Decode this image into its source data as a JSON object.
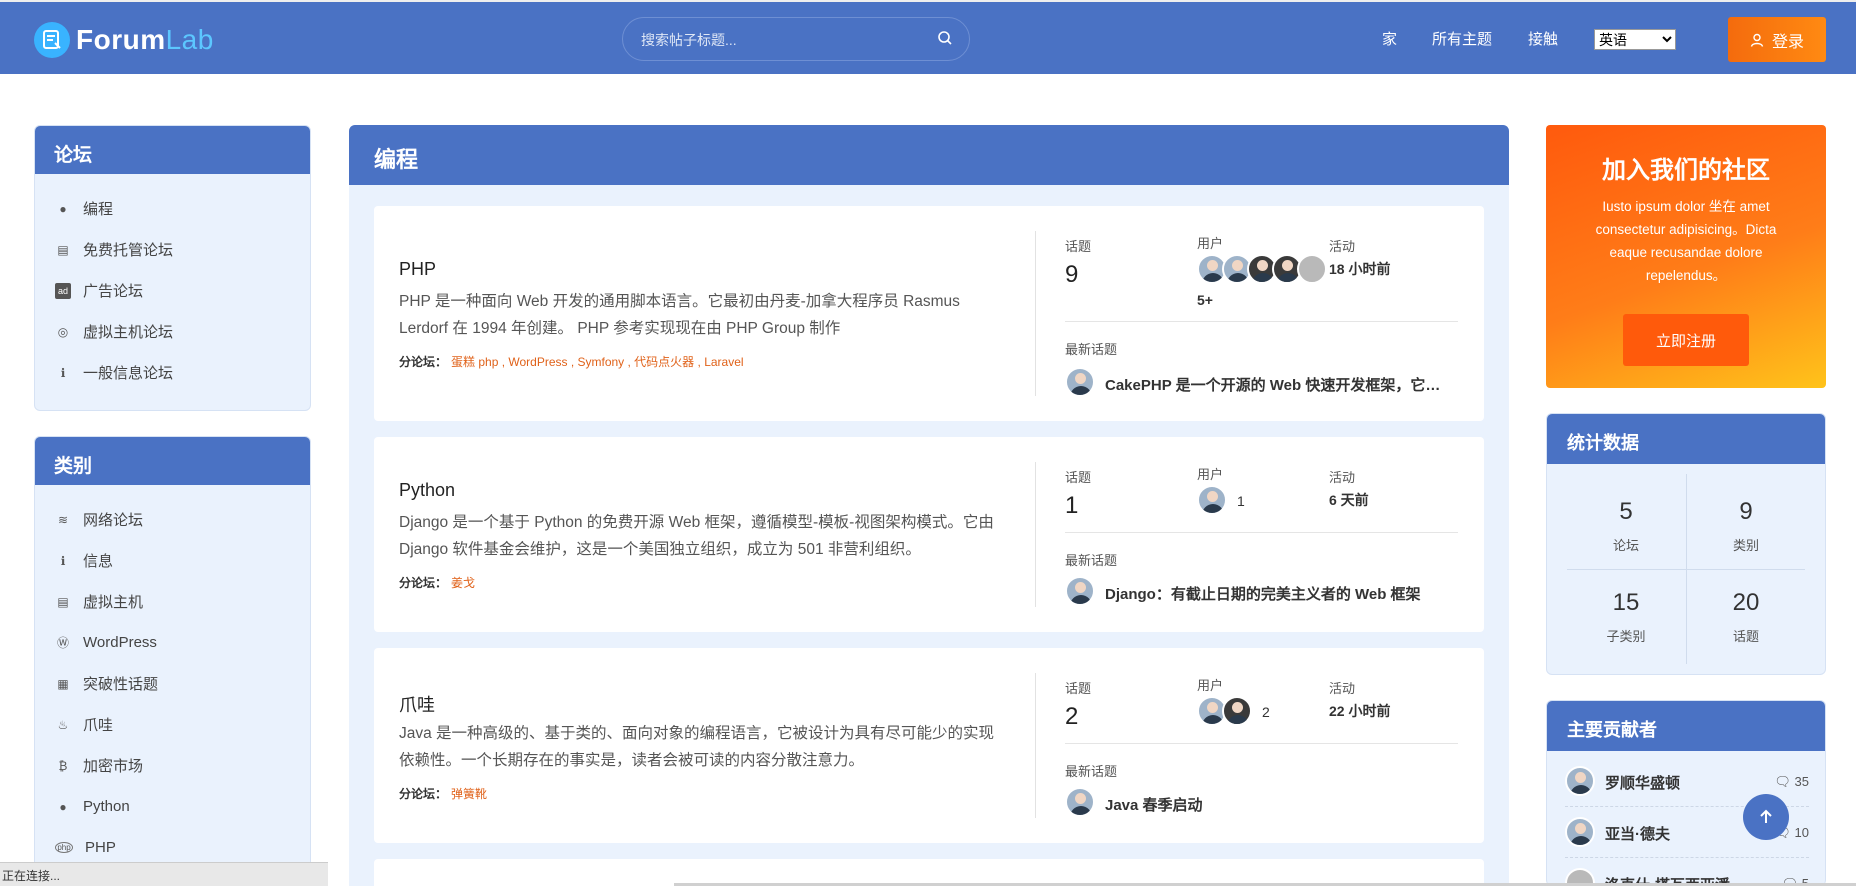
{
  "app": {
    "logo_forum": "Forum",
    "logo_lab": "Lab",
    "colors": {
      "primary": "#4a72c4",
      "accent": "#f46b0d",
      "panel": "#eaf2fd",
      "link": "#e0621a"
    }
  },
  "header": {
    "search_placeholder": "搜索帖子标题...",
    "nav": [
      "家",
      "所有主题",
      "接触"
    ],
    "language": "英语",
    "login_label": "登录"
  },
  "sidebar": {
    "forums_title": "论坛",
    "forums": [
      {
        "label": "编程",
        "icon": "python-icon"
      },
      {
        "label": "免费托管论坛",
        "icon": "server-icon"
      },
      {
        "label": "广告论坛",
        "icon": "ad-icon"
      },
      {
        "label": "虚拟主机论坛",
        "icon": "award-icon"
      },
      {
        "label": "一般信息论坛",
        "icon": "info-icon"
      }
    ],
    "categories_title": "类别",
    "categories": [
      {
        "label": "网络论坛",
        "icon": "network-icon"
      },
      {
        "label": "信息",
        "icon": "info-icon"
      },
      {
        "label": "虚拟主机",
        "icon": "server-icon"
      },
      {
        "label": "WordPress",
        "icon": "wordpress-icon"
      },
      {
        "label": "突破性话题",
        "icon": "newspaper-icon"
      },
      {
        "label": "爪哇",
        "icon": "java-icon"
      },
      {
        "label": "加密市场",
        "icon": "bitcoin-icon"
      },
      {
        "label": "Python",
        "icon": "python-icon"
      },
      {
        "label": "PHP",
        "icon": "php-icon"
      }
    ]
  },
  "main": {
    "title": "编程",
    "labels": {
      "topics": "话题",
      "users": "用户",
      "activity": "活动",
      "latest": "最新话题",
      "subforum": "分论坛："
    },
    "forums": [
      {
        "title": "PHP",
        "description": "PHP 是一种面向 Web 开发的通用脚本语言。它最初由丹麦-加拿大程序员 Rasmus Lerdorf 在 1994 年创建。 PHP 参考实现现在由 PHP Group 制作",
        "subforums": "蛋糕 php , WordPress , Symfony , 代码点火器 , Laravel",
        "topics": "9",
        "users_more": "5+",
        "activity": "18 小时前",
        "latest_topic": "CakePHP 是一个开源的 Web 快速开发框架，它使用 MVC 模式"
      },
      {
        "title": "Python",
        "description": "Django 是一个基于 Python 的免费开源 Web 框架，遵循模型-模板-视图架构模式。它由 Django 软件基金会维护，这是一个美国独立组织，成立为 501 非营利组织。",
        "subforums": "姜戈",
        "topics": "1",
        "users_more": "1",
        "activity": "6 天前",
        "latest_topic": "Django：有截止日期的完美主义者的 Web 框架"
      },
      {
        "title": "爪哇",
        "description": "Java 是一种高级的、基于类的、面向对象的编程语言，它被设计为具有尽可能少的实现依赖性。一个长期存在的事实是，读者会被可读的内容分散注意力。",
        "subforums": "弹簧靴",
        "topics": "2",
        "users_more": "2",
        "activity": "22 小时前",
        "latest_topic": "Java 春季启动"
      }
    ]
  },
  "right": {
    "join_title": "加入我们的社区",
    "join_text": "Iusto ipsum dolor 坐在 amet consectetur adipisicing。Dicta eaque recusandae dolore repelendus。",
    "join_button": "立即注册",
    "stats_title": "统计数据",
    "stats": [
      {
        "value": "5",
        "label": "论坛"
      },
      {
        "value": "9",
        "label": "类别"
      },
      {
        "value": "15",
        "label": "子类别"
      },
      {
        "value": "20",
        "label": "话题"
      }
    ],
    "contrib_title": "主要贡献者",
    "contributors": [
      {
        "name": "罗顺华盛顿",
        "count": "35"
      },
      {
        "name": "亚当·德夫",
        "count": "10"
      },
      {
        "name": "洛克什·塔瓦西亚潘",
        "count": "5"
      }
    ]
  },
  "statusbar": {
    "text": "正在连接..."
  }
}
